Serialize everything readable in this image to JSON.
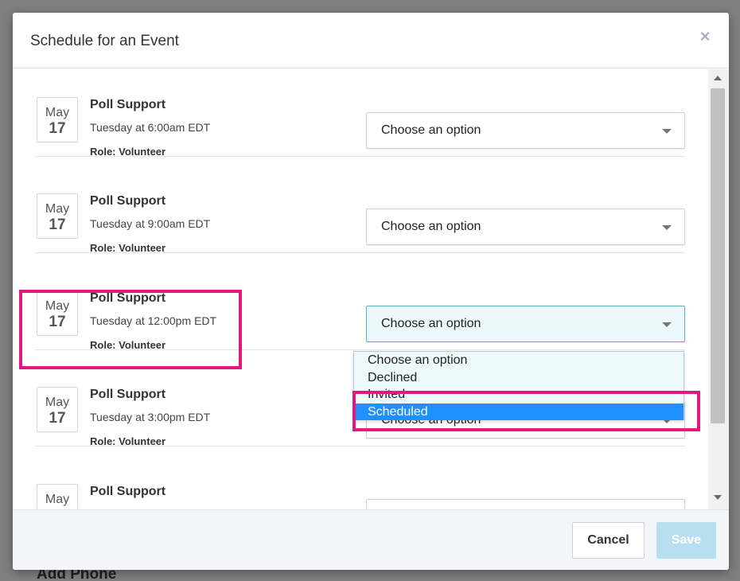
{
  "background": {
    "heading": "Add Phone"
  },
  "modal": {
    "title": "Schedule for an Event",
    "close_icon": "close-icon"
  },
  "events": [
    {
      "month": "May",
      "day": "17",
      "title": "Poll Support",
      "time": "Tuesday at 6:00am EDT",
      "role": "Role: Volunteer",
      "select_value": "Choose an option"
    },
    {
      "month": "May",
      "day": "17",
      "title": "Poll Support",
      "time": "Tuesday at 9:00am EDT",
      "role": "Role: Volunteer",
      "select_value": "Choose an option"
    },
    {
      "month": "May",
      "day": "17",
      "title": "Poll Support",
      "time": "Tuesday at 12:00pm EDT",
      "role": "Role: Volunteer",
      "select_value": "Choose an option"
    },
    {
      "month": "May",
      "day": "17",
      "title": "Poll Support",
      "time": "Tuesday at 3:00pm EDT",
      "role": "Role: Volunteer",
      "select_value": "Choose an option"
    },
    {
      "month": "May",
      "day": "",
      "title": "Poll Support",
      "time": "",
      "role": "",
      "select_value": ""
    }
  ],
  "dropdown": {
    "options": [
      "Choose an option",
      "Declined",
      "Invited",
      "Scheduled"
    ],
    "highlighted": "Scheduled"
  },
  "footer": {
    "cancel_label": "Cancel",
    "save_label": "Save"
  },
  "colors": {
    "highlight_box": "#e0197d",
    "selected_option": "#1e90ff",
    "save_disabled": "#b8dff0"
  }
}
